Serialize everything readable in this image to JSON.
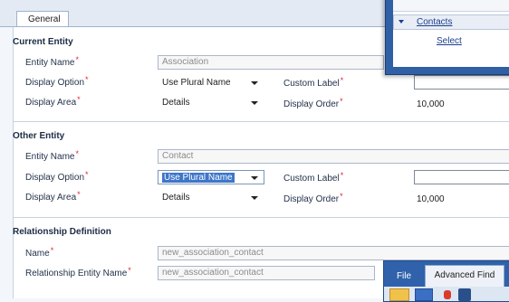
{
  "tabs": {
    "general": "General"
  },
  "sections": {
    "current_entity": "Current Entity",
    "other_entity": "Other Entity",
    "relationship_definition": "Relationship Definition"
  },
  "required_marker": "*",
  "current": {
    "entity_name_label": "Entity Name",
    "entity_name_value": "Association",
    "display_option_label": "Display Option",
    "display_option_value": "Use Plural Name",
    "custom_label_label": "Custom Label",
    "custom_label_value": "",
    "display_area_label": "Display Area",
    "display_area_value": "Details",
    "display_order_label": "Display Order",
    "display_order_value": "10,000"
  },
  "other": {
    "entity_name_label": "Entity Name",
    "entity_name_value": "Contact",
    "display_option_label": "Display Option",
    "display_option_value": "Use Plural Name",
    "custom_label_label": "Custom Label",
    "custom_label_value": "",
    "display_area_label": "Display Area",
    "display_area_value": "Details",
    "display_order_label": "Display Order",
    "display_order_value": "10,000"
  },
  "relationship": {
    "name_label": "Name",
    "name_value": "new_association_contact",
    "rel_entity_name_label": "Relationship Entity Name",
    "rel_entity_name_value": "new_association_contact"
  },
  "popup": {
    "item_contacts": "Contacts",
    "item_select": "Select"
  },
  "ribbon": {
    "file_tab": "File",
    "advanced_find_tab": "Advanced Find"
  },
  "colors": {
    "accent": "#2f62ab",
    "required": "#e8233a",
    "highlight": "#3e76c9"
  }
}
